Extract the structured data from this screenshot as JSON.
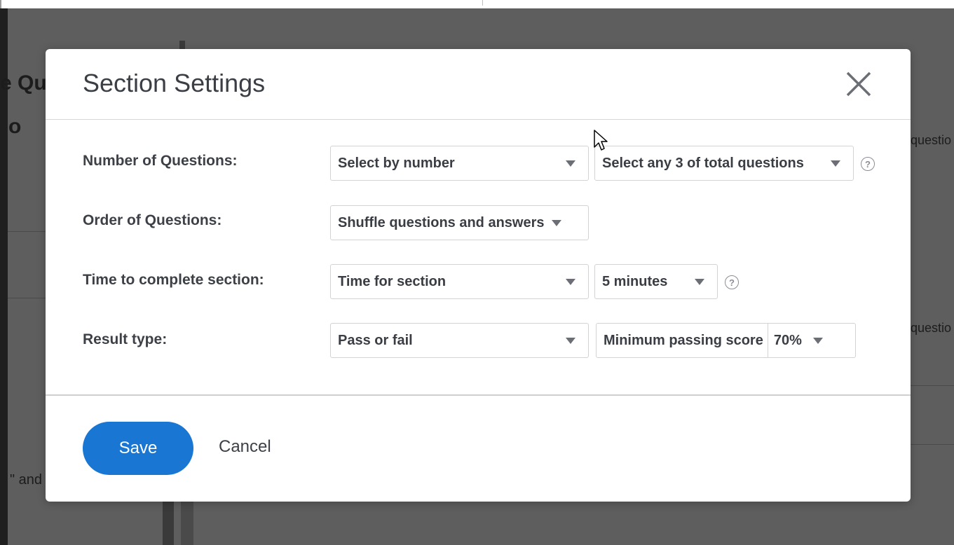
{
  "background": {
    "title_fragment": "e Qu",
    "subtitle_fragment": "o",
    "right_fragment_1": "questio",
    "right_fragment_2": "questio",
    "left_fragment": "\" and"
  },
  "modal": {
    "title": "Section Settings",
    "close_icon": "close-x",
    "rows": {
      "number": {
        "label": "Number of Questions:",
        "mode": "Select by number",
        "count": "Select any 3 of total questions",
        "help": "?"
      },
      "order": {
        "label": "Order of Questions:",
        "mode": "Shuffle questions and answers"
      },
      "time": {
        "label": "Time to complete section:",
        "mode": "Time for section",
        "duration": "5 minutes",
        "help": "?"
      },
      "result": {
        "label": "Result type:",
        "mode": "Pass or fail",
        "min_label": "Minimum passing score",
        "min_value": "70%"
      }
    },
    "footer": {
      "save_label": "Save",
      "cancel_label": "Cancel"
    }
  },
  "colors": {
    "primary": "#1976d2",
    "backdrop": "#5e5e5e"
  }
}
